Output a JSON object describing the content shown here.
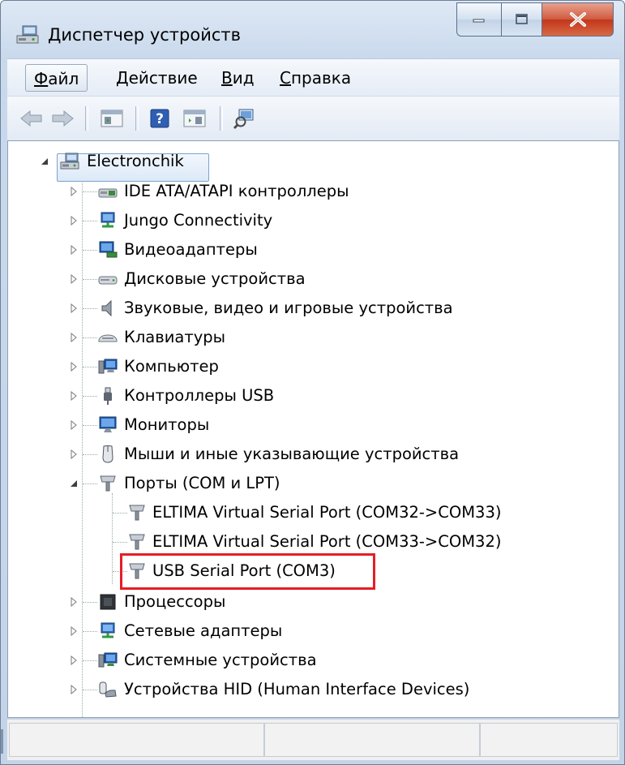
{
  "window": {
    "title": "Диспетчер устройств",
    "title_icon": "device-manager-icon"
  },
  "caption_buttons": [
    "minimize-icon",
    "maximize-icon",
    "close-icon"
  ],
  "menu": {
    "items": [
      {
        "first": "Ф",
        "rest": "айл",
        "name": "menu-file",
        "active": true
      },
      {
        "first": "Д",
        "rest": "ействие",
        "name": "menu-action",
        "active": false
      },
      {
        "first": "В",
        "rest": "ид",
        "name": "menu-view",
        "active": false
      },
      {
        "first": "С",
        "rest": "правка",
        "name": "menu-help",
        "active": false
      }
    ]
  },
  "toolbar": {
    "icons": [
      "back-arrow-icon",
      "forward-arrow-icon",
      "properties-pane-icon",
      "help-icon",
      "action-pane-icon",
      "scan-hardware-icon"
    ]
  },
  "tree": {
    "root": {
      "label": "Electronchik",
      "icon": "computer-network-icon",
      "expanded": true
    },
    "categories": [
      {
        "label": "IDE ATA/ATAPI контроллеры",
        "icon": "ide-controller-icon",
        "expanded": false
      },
      {
        "label": "Jungo Connectivity",
        "icon": "network-monitor-icon",
        "expanded": false
      },
      {
        "label": "Видеоадаптеры",
        "icon": "display-adapter-icon",
        "expanded": false
      },
      {
        "label": "Дисковые устройства",
        "icon": "disk-drive-icon",
        "expanded": false
      },
      {
        "label": "Звуковые, видео и игровые устройства",
        "icon": "speaker-icon",
        "expanded": false
      },
      {
        "label": "Клавиатуры",
        "icon": "keyboard-icon",
        "expanded": false
      },
      {
        "label": "Компьютер",
        "icon": "computer-icon",
        "expanded": false
      },
      {
        "label": "Контроллеры USB",
        "icon": "usb-plug-icon",
        "expanded": false
      },
      {
        "label": "Мониторы",
        "icon": "monitor-icon",
        "expanded": false
      },
      {
        "label": "Мыши и иные указывающие устройства",
        "icon": "mouse-icon",
        "expanded": false
      },
      {
        "label": "Порты (COM и LPT)",
        "icon": "port-icon",
        "expanded": true,
        "children": [
          {
            "label": "ELTIMA Virtual Serial Port (COM32->COM33)",
            "icon": "port-icon"
          },
          {
            "label": "ELTIMA Virtual Serial Port (COM33->COM32)",
            "icon": "port-icon"
          },
          {
            "label": "USB Serial Port (COM3)",
            "icon": "port-icon",
            "highlighted": true
          }
        ]
      },
      {
        "label": "Процессоры",
        "icon": "processor-icon",
        "expanded": false
      },
      {
        "label": "Сетевые адаптеры",
        "icon": "network-adapter-icon",
        "expanded": false
      },
      {
        "label": "Системные устройства",
        "icon": "system-devices-icon",
        "expanded": false
      },
      {
        "label": "Устройства HID (Human Interface Devices)",
        "icon": "hid-device-icon",
        "expanded": false
      }
    ]
  },
  "highlight_color": "#e41e26",
  "statusbar": {
    "panes": [
      "",
      "",
      ""
    ]
  }
}
